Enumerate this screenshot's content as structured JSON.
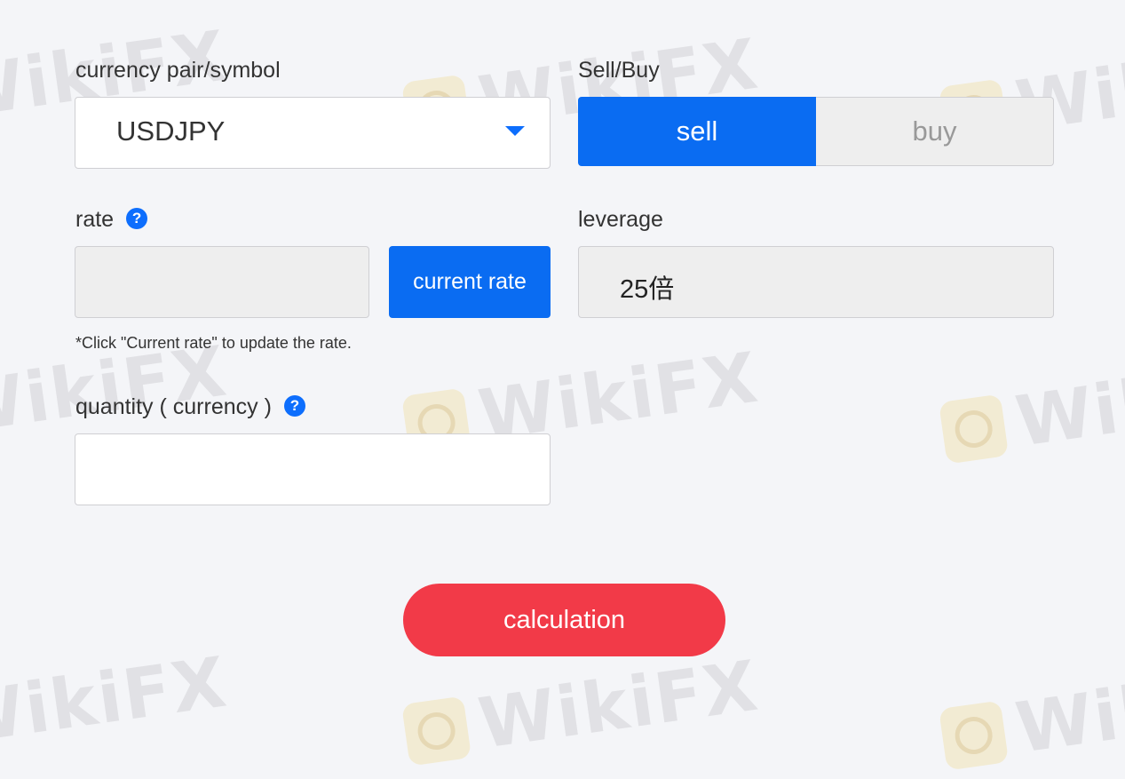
{
  "watermark": {
    "text": "WikiFX"
  },
  "form": {
    "currency_pair": {
      "label": "currency pair/symbol",
      "value": "USDJPY"
    },
    "sell_buy": {
      "label": "Sell/Buy",
      "sell_label": "sell",
      "buy_label": "buy",
      "selected": "sell"
    },
    "rate": {
      "label": "rate",
      "help": "?",
      "value": "",
      "current_rate_button": "current rate",
      "note": "*Click \"Current rate\" to update the rate."
    },
    "leverage": {
      "label": "leverage",
      "value": "25倍"
    },
    "quantity": {
      "label": "quantity ( currency )",
      "help": "?",
      "value": ""
    },
    "calculate_button": "calculation"
  },
  "colors": {
    "accent": "#0a6cf2",
    "calculate": "#f23a48",
    "background": "#f4f5f8"
  }
}
